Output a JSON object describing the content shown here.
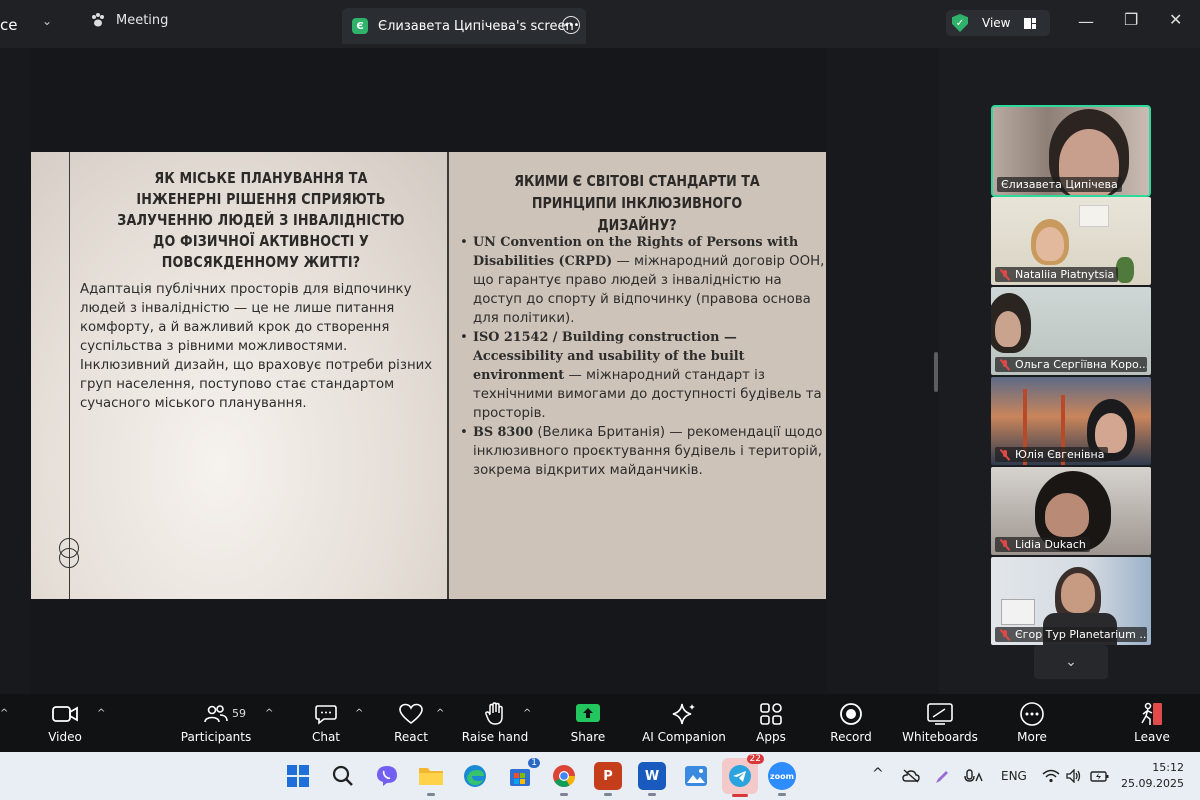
{
  "titlebar": {
    "left_cut_text": "ce",
    "meeting_label": "Meeting",
    "tab_badge": "Є",
    "tab_label": "Єлизавета Ципічева's screen",
    "view_label": "View"
  },
  "slide": {
    "left_heading": "ЯК МІСЬКЕ ПЛАНУВАННЯ ТА ІНЖЕНЕРНІ РІШЕННЯ СПРИЯЮТЬ ЗАЛУЧЕННЮ ЛЮДЕЙ З ІНВАЛІДНІСТЮ ДО ФІЗИЧНОЇ АКТИВНОСТІ У ПОВСЯКДЕННОМУ ЖИТТІ?",
    "left_body": "Адаптація публічних просторів для відпочинку людей з інвалідністю — це не лише питання комфорту, а й важливий крок до створення суспільства з рівними можливостями. Інклюзивний дизайн, що враховує потреби різних груп населення, поступово стає стандартом сучасного міського планування.",
    "right_heading": "ЯКИМИ Є СВІТОВІ СТАНДАРТИ ТА ПРИНЦИПИ ІНКЛЮЗИВНОГО ДИЗАЙНУ?",
    "bullets": [
      {
        "bold": "UN Convention on the Rights of Persons with Disabilities (CRPD)",
        "text": " — міжнародний договір ООН, що гарантує право людей з інвалідністю на доступ до спорту й відпочинку (правова основа для політики)."
      },
      {
        "bold": "ISO 21542 / Building construction — Accessibility and usability of the built environment",
        "text": " — міжнародний стандарт із технічними вимогами до доступності будівель та просторів."
      },
      {
        "bold": "BS 8300",
        "text": " (Велика Британія) — рекомендації щодо інклюзивного проєктування будівель і територій, зокрема відкритих майданчиків."
      }
    ]
  },
  "participants": [
    {
      "name": "Єлизавета Ципічева",
      "muted": false,
      "active": true
    },
    {
      "name": "Nataliia Piatnytsia",
      "muted": true,
      "active": false
    },
    {
      "name": "Ольга Сергіївна Коро...",
      "muted": true,
      "active": false
    },
    {
      "name": "Юлія Євгенівна",
      "muted": true,
      "active": false
    },
    {
      "name": "Lidia Dukach",
      "muted": true,
      "active": false
    },
    {
      "name": "Єгор Тур Planetarium ...",
      "muted": true,
      "active": false
    }
  ],
  "toolbar": {
    "video": "Video",
    "participants": "Participants",
    "participants_count": "59",
    "chat": "Chat",
    "react": "React",
    "raise_hand": "Raise hand",
    "share": "Share",
    "ai_companion": "AI Companion",
    "apps": "Apps",
    "record": "Record",
    "whiteboards": "Whiteboards",
    "more": "More",
    "leave": "Leave"
  },
  "taskbar": {
    "store_badge": "1",
    "telegram_badge": "22",
    "word_label": "W",
    "ppt_label": "P",
    "zoom_label": "zoom",
    "lang": "ENG",
    "time": "15:12",
    "date": "25.09.2025"
  },
  "colors": {
    "active_speaker_border": "#2fd89b",
    "share_green": "#2fb36b",
    "leave_red": "#e24b4b"
  }
}
